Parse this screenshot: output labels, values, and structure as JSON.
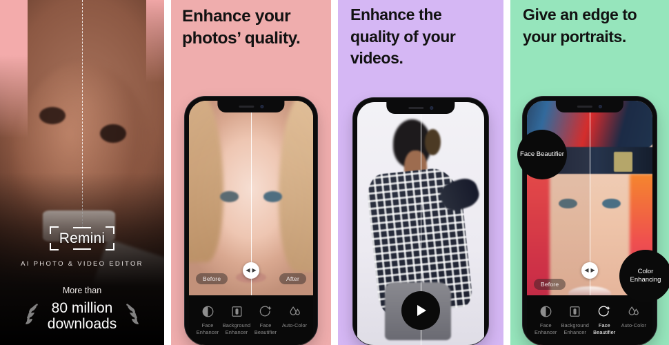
{
  "app": {
    "name": "Remini",
    "tagline": "AI PHOTO & VIDEO EDITOR",
    "more_than_label": "More than",
    "downloads_count": "80 million",
    "downloads_word": "downloads",
    "logo_icon": "photo-frame-brackets-icon",
    "laurel_left_icon": "laurel-branch-left-icon",
    "laurel_right_icon": "laurel-branch-right-icon"
  },
  "colors": {
    "panel1_bg": "#120a07",
    "panel2_bg": "#efadad",
    "panel3_bg": "#d5b7f4",
    "panel4_bg": "#96e5bc",
    "headline_text": "#121212",
    "toolbar_bg": "#090909",
    "badge_bg": "#0a0a0a",
    "active_tool": "#ffffff",
    "inactive_tool": "#8e8e8e"
  },
  "panels": [
    {
      "id": "hero",
      "kind": "brand-hero",
      "headline": ""
    },
    {
      "id": "photos",
      "kind": "phone-screenshot",
      "headline": "Enhance your photos’ quality.",
      "slider": {
        "before_label": "Before",
        "after_label": "After",
        "handle_icon": "split-drag-handle-icon"
      },
      "toolbar": [
        {
          "label": "Face Enhancer",
          "icon": "half-circle-contrast-icon",
          "active": false
        },
        {
          "label": "Background Enhancer",
          "icon": "framed-portrait-icon",
          "active": false
        },
        {
          "label": "Face Beautifier",
          "icon": "sparkle-face-icon",
          "active": false
        },
        {
          "label": "Auto-Color",
          "icon": "water-drops-icon",
          "active": false
        }
      ]
    },
    {
      "id": "videos",
      "kind": "phone-video",
      "headline": "Enhance the quality of your videos.",
      "play_button": {
        "icon": "play-triangle-icon",
        "label": ""
      }
    },
    {
      "id": "portraits",
      "kind": "phone-screenshot",
      "headline": "Give an edge to your portraits.",
      "badges": [
        {
          "label": "Face Beautifier"
        },
        {
          "label": "Color Enhancing"
        }
      ],
      "slider": {
        "before_label": "Before",
        "after_label": "",
        "handle_icon": "split-drag-handle-icon"
      },
      "toolbar": [
        {
          "label": "Face Enhancer",
          "icon": "half-circle-contrast-icon",
          "active": false
        },
        {
          "label": "Background Enhancer",
          "icon": "framed-portrait-icon",
          "active": false
        },
        {
          "label": "Face Beautifier",
          "icon": "sparkle-face-icon",
          "active": true
        },
        {
          "label": "Auto-Color",
          "icon": "water-drops-icon",
          "active": false
        }
      ]
    }
  ]
}
